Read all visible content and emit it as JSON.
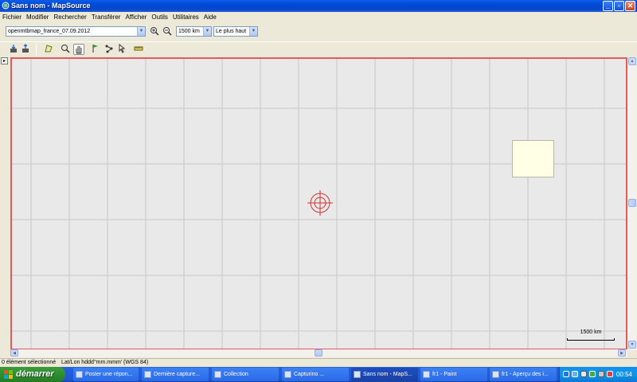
{
  "window": {
    "title": "Sans nom - MapSource"
  },
  "menu": [
    "Fichier",
    "Modifier",
    "Rechercher",
    "Transférer",
    "Afficher",
    "Outils",
    "Utilitaires",
    "Aide"
  ],
  "toolbar": {
    "map_product": "openmtbmap_france_07.09.2012",
    "zoom_level": "1500 km",
    "detail_level": "Le plus haut"
  },
  "map": {
    "scale_label": "1500 km"
  },
  "status": {
    "selection": "0 élément sélectionné",
    "coords_format": "Lat/Lon hddd°mm.mmm' (WGS 84)"
  },
  "taskbar": {
    "start_label": "démarrer",
    "tasks": [
      {
        "label": "Poster une répon..."
      },
      {
        "label": "Dernière capture..."
      },
      {
        "label": "Collection"
      },
      {
        "label": "Capturino ..."
      },
      {
        "label": "Sans nom - MapS..."
      },
      {
        "label": "fr1 - Paint"
      },
      {
        "label": "fr1 - Aperçu des i..."
      }
    ],
    "clock": "00:54"
  },
  "colors": {
    "map_border": "#e25a5a",
    "map_bg": "#e9e9e9",
    "grid": "#c8c8c8",
    "crosshair": "#d83030",
    "inset_bg": "#ffffe5",
    "titlebar": "#0a5ee8",
    "start_green": "#2f8f2f"
  }
}
